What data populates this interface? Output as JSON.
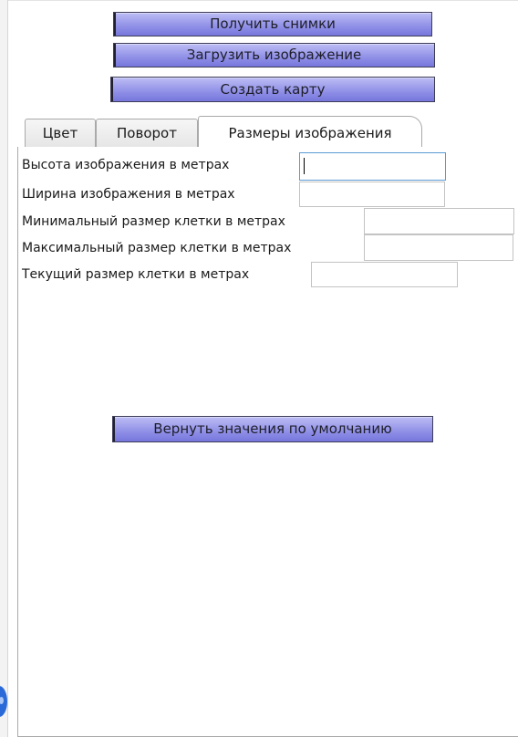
{
  "buttons": {
    "get_snapshots": "Получить снимки",
    "load_image": "Загрузить изображение",
    "create_map": "Создать карту"
  },
  "tabs": [
    {
      "label": "Цвет",
      "active": false
    },
    {
      "label": "Поворот",
      "active": false
    },
    {
      "label": "Размеры изображения",
      "active": true
    }
  ],
  "fields": {
    "image_height": {
      "label": "Высота изображения в метрах",
      "value": ""
    },
    "image_width": {
      "label": "Ширина изображения в метрах",
      "value": ""
    },
    "min_cell": {
      "label": "Минимальный размер клетки в метрах",
      "value": ""
    },
    "max_cell": {
      "label": "Максимальный размер клетки в метрах",
      "value": ""
    },
    "current_cell": {
      "label": "Текущий размер клетки в метрах",
      "value": ""
    }
  },
  "reset_button": "Вернуть значения по умолчанию",
  "colors": {
    "button_gradient_top": "#bdbdf5",
    "button_gradient_bottom": "#7676dc",
    "focus_border": "#5b9bd5",
    "tab_border": "#a9a9a9"
  }
}
